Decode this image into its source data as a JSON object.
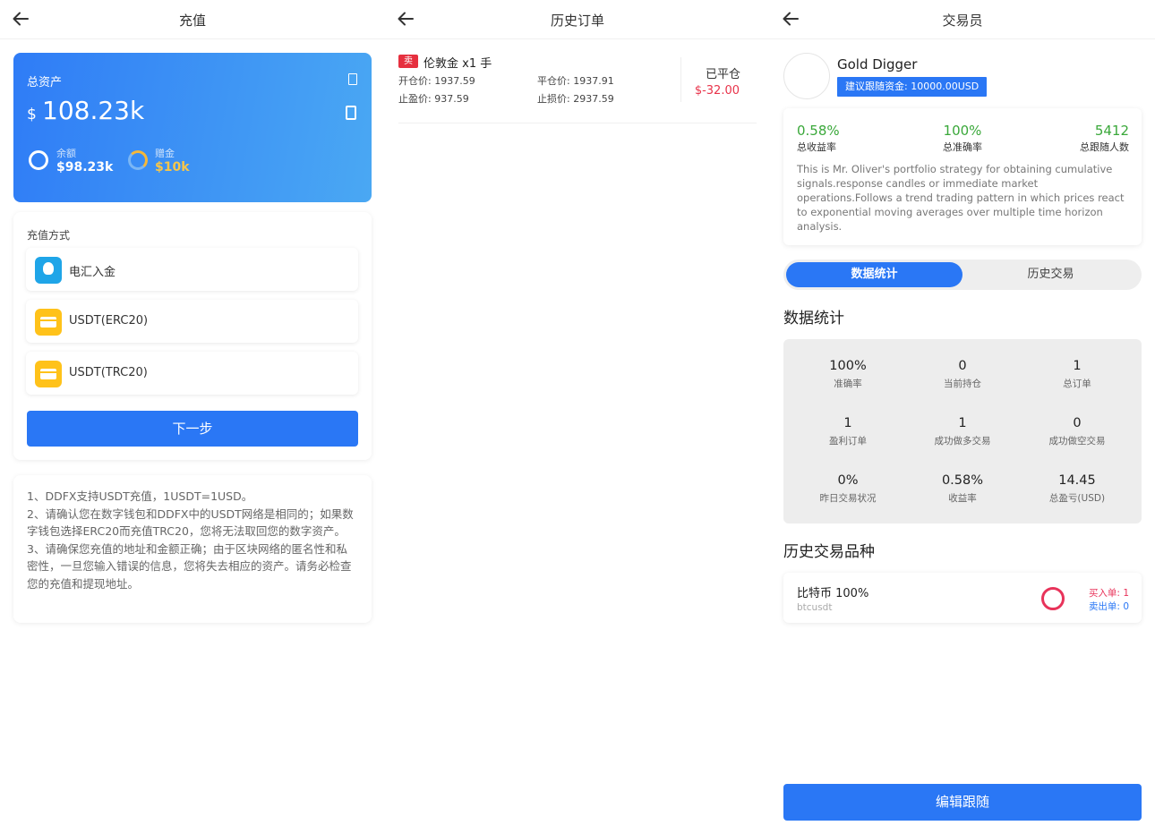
{
  "recharge": {
    "title": "充值",
    "total_label": "总资产",
    "currency_symbol": "$",
    "total_value": "108.23k",
    "balance_label": "余额",
    "balance_value": "$98.23k",
    "bonus_label": "赠金",
    "bonus_value": "$10k",
    "method_title": "充值方式",
    "methods": [
      {
        "label": "电汇入金",
        "icon": "wire-transfer-icon",
        "color": "#1fa5e8"
      },
      {
        "label": "USDT(ERC20)",
        "icon": "card-icon",
        "color": "#ffc21a"
      },
      {
        "label": "USDT(TRC20)",
        "icon": "card-icon",
        "color": "#ffc21a"
      }
    ],
    "next_label": "下一步",
    "notes": [
      "1、DDFX支持USDT充值，1USDT=1USD。",
      "2、请确认您在数字钱包和DDFX中的USDT网络是相同的；如果数字钱包选择ERC20而充值TRC20，您将无法取回您的数字资产。",
      "3、请确保您充值的地址和金额正确；由于区块网络的匿名性和私密性，一旦您输入错误的信息，您将失去相应的资产。请务必检查您的充值和提现地址。"
    ]
  },
  "history": {
    "title": "历史订单",
    "order": {
      "tag": "卖",
      "name": "伦敦金 x1 手",
      "open_price": "开仓价: 1937.59",
      "close_price": "平仓价: 1937.91",
      "take_profit": "止盈价: 937.59",
      "stop_loss": "止损价: 2937.59",
      "status": "已平仓",
      "pnl": "$-32.00"
    }
  },
  "trader": {
    "title": "交易员",
    "name": "Gold Digger",
    "suggest": "建议跟随资金: 10000.00USD",
    "metrics": [
      {
        "value": "0.58%",
        "label": "总收益率"
      },
      {
        "value": "100%",
        "label": "总准确率"
      },
      {
        "value": "5412",
        "label": "总跟随人数"
      }
    ],
    "description": "This is Mr. Oliver's portfolio strategy for obtaining cumulative signals.response candles or immediate market operations.Follows a trend trading pattern in which prices react to exponential moving averages over multiple time horizon analysis.",
    "tabs": [
      "数据统计",
      "历史交易"
    ],
    "stats_title": "数据统计",
    "stats": [
      {
        "value": "100%",
        "label": "准确率"
      },
      {
        "value": "0",
        "label": "当前持仓"
      },
      {
        "value": "1",
        "label": "总订单"
      },
      {
        "value": "1",
        "label": "盈利订单"
      },
      {
        "value": "1",
        "label": "成功做多交易"
      },
      {
        "value": "0",
        "label": "成功做空交易"
      },
      {
        "value": "0%",
        "label": "昨日交易状况"
      },
      {
        "value": "0.58%",
        "label": "收益率"
      },
      {
        "value": "14.45",
        "label": "总盈亏(USD)"
      }
    ],
    "variety_title": "历史交易品种",
    "variety": {
      "name": "比特币 100%",
      "symbol": "btcusdt",
      "buy": "买入单: 1",
      "sell": "卖出单: 0"
    },
    "edit_label": "编辑跟随"
  },
  "colors": {
    "primary": "#2a77f5",
    "profit_green": "#3aa83a",
    "loss_red": "#e8334a",
    "bonus_gold": "#f7c649"
  }
}
